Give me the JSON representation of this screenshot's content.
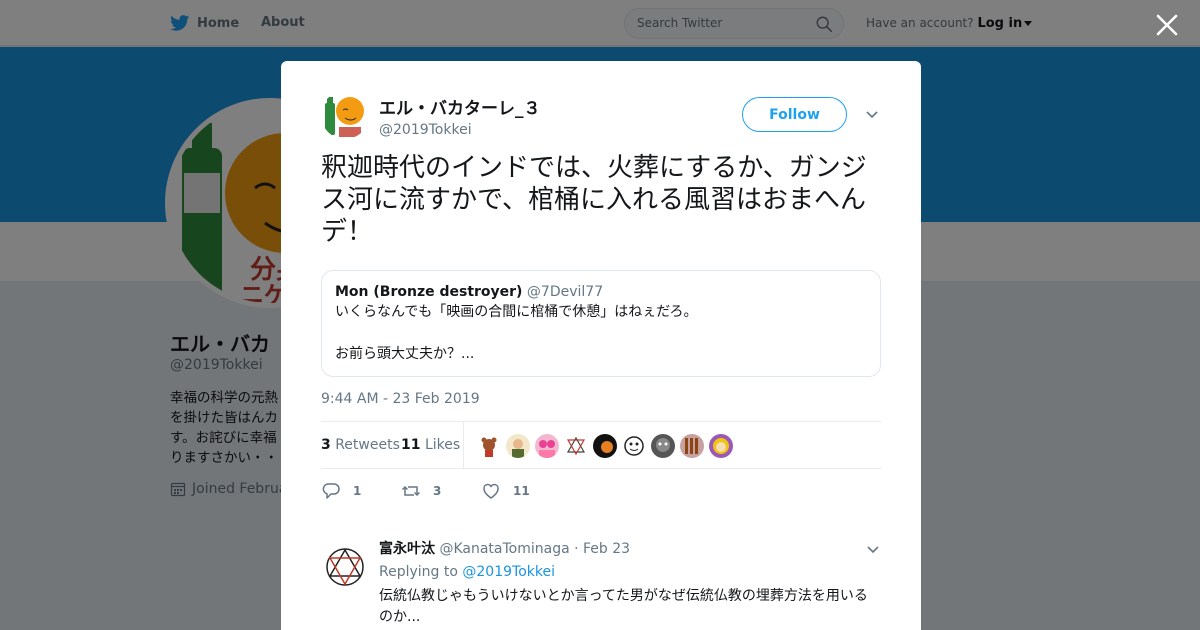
{
  "topnav": {
    "home_label": "Home",
    "about_label": "About",
    "search_placeholder": "Search Twitter",
    "have_account": "Have an account?",
    "login_label": "Log in"
  },
  "profile_bg": {
    "name": "エル・バカ",
    "handle": "@2019Tokkei",
    "bio_lines": [
      "幸福の科学の元熱",
      "を掛けた皆はんカ",
      "す。お詫びに幸福",
      "りますさかい・・"
    ],
    "joined": "Joined Februa",
    "avatar_text": "分身\nニゲン"
  },
  "tweet": {
    "author_name": "エル・バカターレ_３",
    "author_handle": "@2019Tokkei",
    "follow_label": "Follow",
    "text": "釈迦時代のインドでは、火葬にするか、ガンジス河に流すかで、棺桶に入れる風習はおまへんデ！",
    "quote": {
      "name": "Mon (Bronze destroyer)",
      "handle": "@7Devil77",
      "line1": "いくらなんでも「映画の合間に棺桶で休憩」はねぇだろ。",
      "line2": "お前ら頭大丈夫か？..."
    },
    "timestamp": "9:44 AM - 23 Feb 2019",
    "retweets_count": "3",
    "retweets_label": "Retweets",
    "likes_count": "11",
    "likes_label": "Likes",
    "actions": {
      "reply_count": "1",
      "retweet_count": "3",
      "like_count": "11"
    }
  },
  "reply": {
    "name": "富永叶汰",
    "meta": "@KanataTominaga · Feb 23",
    "replying_prefix": "Replying to",
    "replying_handle": "@2019Tokkei",
    "text": "伝統仏教じゃもういけないとか言ってた男がなぜ伝統仏教の埋葬方法を用いるのか..."
  },
  "colors": {
    "brand_blue": "#1da1f2",
    "cover_blue": "#1b95e0",
    "text_gray": "#657786"
  }
}
